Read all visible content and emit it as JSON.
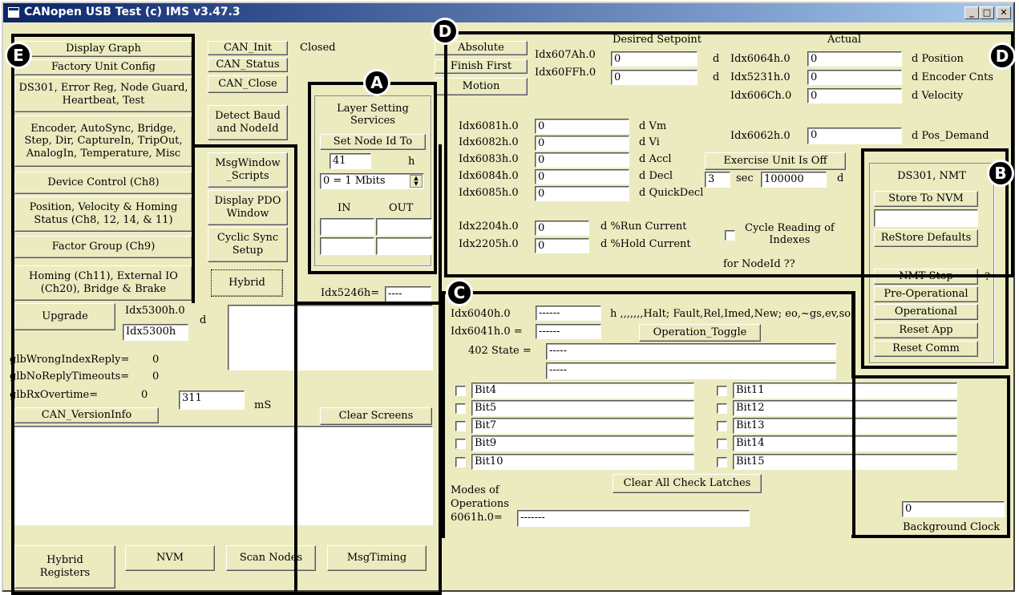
{
  "window": {
    "title": "CANopen USB Test (c) IMS v3.47.3",
    "min_label": "_",
    "max_label": "□",
    "close_label": "✕"
  },
  "left": {
    "display_graph": "Display Graph",
    "factory_unit_config": "Factory Unit Config",
    "ds301": "DS301, Error Reg, Node Guard,\nHeartbeat, Test",
    "encoder": "Encoder, AutoSync, Bridge,\nStep, Dir, CaptureIn, TripOut,\nAnalogIn, Temperature, Misc",
    "device_control": "Device Control (Ch8)",
    "position_velocity": "Position, Velocity & Homing\nStatus (Ch8, 12, 14, & 11)",
    "factor_group": "Factor Group (Ch9)",
    "homing": "Homing (Ch11), External IO\n(Ch20),  Bridge & Brake",
    "upgrade": "Upgrade",
    "idx5300_label": "Idx5300h.0",
    "idx5300_unit": "d",
    "idx5300_value": "Idx5300h",
    "wrong_index_label": "glbWrongIndexReply=",
    "wrong_index_value": "0",
    "no_reply_label": "glbNoReplyTimeouts=",
    "no_reply_value": "0",
    "rx_overtime_label": "glbRxOvertime=",
    "rx_overtime_value": "0",
    "rx_overtime_field": "311",
    "ms_label": "mS",
    "can_version_info": "CAN_VersionInfo",
    "hybrid_registers": "Hybrid\nRegisters",
    "nvm": "NVM",
    "scan_nodes": "Scan Nodes",
    "msg_timing": "MsgTiming"
  },
  "middle": {
    "can_init": "CAN_Init",
    "can_init_status": "Closed",
    "can_status": "CAN_Status",
    "can_close": "CAN_Close",
    "detect_baud": "Detect Baud\nand NodeId",
    "msg_window": "MsgWindow\n_Scripts",
    "display_pdo": "Display PDO\nWindow",
    "cyclic_sync": "Cyclic Sync\nSetup",
    "hybrid": "Hybrid",
    "layer_title": "Layer Setting\nServices",
    "set_node_id": "Set Node Id To",
    "node_id_value": "41",
    "node_id_unit": "h",
    "baud_selected": "0 = 1 Mbits",
    "in_label": "IN",
    "out_label": "OUT",
    "idx5246_label": "Idx5246h=",
    "idx5246_value": "----",
    "clear_screens": "Clear Screens"
  },
  "motion": {
    "absolute": "Absolute",
    "finish_first": "Finish First",
    "motion_btn": "Motion",
    "desired_setpoint": "Desired Setpoint",
    "actual": "Actual",
    "idx607a": "Idx607Ah.0",
    "idx607a_value": "0",
    "idx60ff": "Idx60FFh.0",
    "idx60ff_value": "0",
    "unit_d": "d",
    "idx6064": "Idx6064h.0",
    "idx6064_value": "0",
    "idx6064_unit": "d Position",
    "idx5231": "Idx5231h.0",
    "idx5231_value": "0",
    "idx5231_unit": "d Encoder Cnts",
    "idx606c": "Idx606Ch.0",
    "idx606c_value": "0",
    "idx606c_unit": "d Velocity",
    "idx6081": "Idx6081h.0",
    "idx6081_value": "0",
    "idx6081_unit": "d Vm",
    "idx6082": "Idx6082h.0",
    "idx6082_value": "0",
    "idx6082_unit": "d Vi",
    "idx6083": "Idx6083h.0",
    "idx6083_value": "0",
    "idx6083_unit": "d Accl",
    "idx6084": "Idx6084h.0",
    "idx6084_value": "0",
    "idx6084_unit": "d Decl",
    "idx6085": "Idx6085h.0",
    "idx6085_value": "0",
    "idx6085_unit": "d QuickDecl",
    "idx6062": "Idx6062h.0",
    "idx6062_value": "0",
    "idx6062_unit": "d Pos_Demand",
    "exercise": "Exercise Unit Is Off",
    "exercise_sec_value": "3",
    "sec_label": "sec",
    "exercise_distance": "100000",
    "exercise_unit": "d",
    "idx2204": "Idx2204h.0",
    "idx2204_value": "0",
    "idx2204_unit": "d %Run Current",
    "idx2205": "Idx2205h.0",
    "idx2205_value": "0",
    "idx2205_unit": "d %Hold Current",
    "cycle_reading": "Cycle Reading of\nIndexes",
    "for_node": "for NodeId ??"
  },
  "nmt": {
    "title": "DS301, NMT",
    "store_nvm": "Store To NVM",
    "store_field": "",
    "restore_defaults": "ReStore Defaults",
    "nmt_stop": "NMT Stop",
    "question": "?",
    "pre_operational": "Pre-Operational",
    "operational": "Operational",
    "reset_app": "Reset App",
    "reset_comm": "Reset Comm"
  },
  "status": {
    "idx6040": "Idx6040h.0",
    "idx6040_value": "------",
    "idx6040_desc": "h ,,,,,,,Halt; Fault,Rel,Imed,New; eo,~gs,ev,so",
    "idx6041": "Idx6041h.0 =",
    "idx6041_value": "------",
    "operation_toggle": "Operation_Toggle",
    "state402": "402 State =",
    "state_value1": "-----",
    "state_value2": "-----",
    "bits_left": [
      "Bit4",
      "Bit5",
      "Bit7",
      "Bit9",
      "Bit10"
    ],
    "bits_right": [
      "Bit11",
      "Bit12",
      "Bit13",
      "Bit14",
      "Bit15"
    ],
    "clear_latches": "Clear All Check Latches",
    "modes_label": "Modes of\nOperations\n6061h.0=",
    "modes_value": "-------",
    "bg_clock_value": "0",
    "bg_clock_label": "Background Clock"
  },
  "markers": {
    "a": "A",
    "b": "B",
    "c": "C",
    "d": "D",
    "e": "E"
  }
}
